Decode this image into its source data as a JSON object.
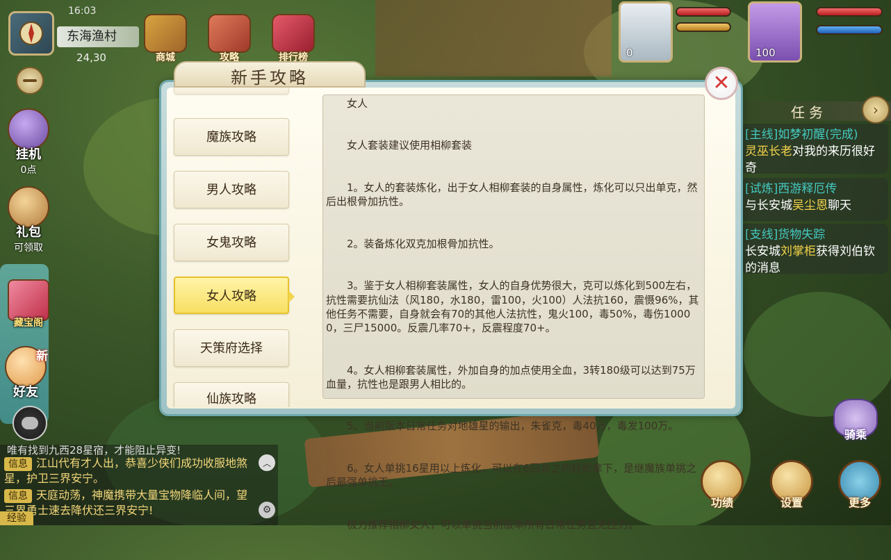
{
  "top_left": {
    "clock": "16:03",
    "location": "东海渔村",
    "coords": "24,30"
  },
  "top_icons": [
    {
      "label": "商城",
      "icon": "mall-icon"
    },
    {
      "label": "攻略",
      "icon": "guide-icon"
    },
    {
      "label": "排行榜",
      "icon": "ranking-icon"
    }
  ],
  "portraits": {
    "pet_level": "0",
    "hero_level": "100"
  },
  "left_side": {
    "idle_label": "挂机",
    "idle_points": "0点",
    "gift_label": "礼包",
    "gift_sub": "可领取",
    "treasure_label": "藏宝阁",
    "friend_label": "好友",
    "friend_badge": "新"
  },
  "chat": {
    "top_line": "唯有找到九西28星宿，才能阻止异变!",
    "lines": [
      {
        "tag": "信息",
        "text": "江山代有才人出，恭喜少侠们成功收服地煞星，护卫三界安宁。"
      },
      {
        "tag": "信息",
        "text": "天庭动荡，神魔携带大量宝物降临人间，望三界勇士速去降伏还三界安宁!"
      }
    ],
    "exp_tag": "经验"
  },
  "tasks": {
    "header": "任务",
    "items": [
      {
        "title": "[主线]如梦初醒(完成)",
        "npc": "灵巫长老",
        "text": "对我的来历很好奇"
      },
      {
        "title": "[试炼]西游释厄传",
        "prefix": "与长安城",
        "npc": "吴尘恩",
        "text": "聊天"
      },
      {
        "title": "[支线]货物失踪",
        "prefix": "长安城",
        "npc": "刘掌柜",
        "text": "获得刘伯钦的消息"
      }
    ]
  },
  "bottom_right": {
    "mount": "骑乘",
    "achievements": "功绩",
    "settings": "设置",
    "more": "更多"
  },
  "guide": {
    "title": "新手攻略",
    "nav_items": [
      {
        "label": "魔族攻略",
        "active": false
      },
      {
        "label": "男人攻略",
        "active": false
      },
      {
        "label": "女鬼攻略",
        "active": false
      },
      {
        "label": "女人攻略",
        "active": true
      },
      {
        "label": "天策府选择",
        "active": false
      },
      {
        "label": "仙族攻略",
        "active": false
      }
    ],
    "content_title": "女人",
    "content_paragraphs": [
      "女人套装建议使用相柳套装",
      "1。女人的套装炼化，出于女人相柳套装的自身属性，炼化可以只出单克，然后出根骨加抗性。",
      "2。装备炼化双克加根骨加抗性。",
      "3。鉴于女人相柳套装属性，女人的自身优势很大，克可以炼化到500左右，抗性需要抗仙法（风180，水180，雷100，火100）人法抗160，震慑96%，其他任务不需要，自身就会有70的其他人法抗性，鬼火100，毒50%，毒伤10000，三尸15000。反震几率70+，反震程度70+。",
      "4。女人相柳套装属性，外加自身的加点使用全血，3转180级可以达到75万血量，抗性也是跟男人相比的。",
      "5。当前版本日常任务对地雄星的输出，朱雀克，毒40万，毒发100万。",
      "6。女人单挑16星用以上炼化，可以在6回合之内轻松拿下，是继魔族单挑之后最强单挑王。",
      "极力推荐相柳女人，可以单挑当前版本所有日常任务且无压力。"
    ]
  },
  "colors": {
    "accent_gold": "#f7df62",
    "task_title": "#45c9c0",
    "npc_name": "#f4d34a",
    "close_red": "#d63a3a"
  }
}
